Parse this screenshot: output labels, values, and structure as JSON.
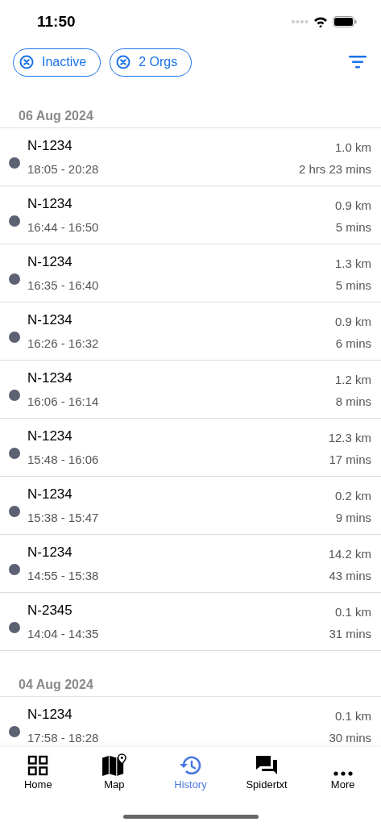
{
  "status_bar": {
    "time": "11:50"
  },
  "filters": [
    {
      "label": "Inactive"
    },
    {
      "label": "2 Orgs"
    }
  ],
  "sections": [
    {
      "date": "06 Aug 2024",
      "trips": [
        {
          "name": "N-1234",
          "time": "18:05 - 20:28",
          "distance": "1.0 km",
          "duration": "2 hrs 23 mins"
        },
        {
          "name": "N-1234",
          "time": "16:44 - 16:50",
          "distance": "0.9 km",
          "duration": "5 mins"
        },
        {
          "name": "N-1234",
          "time": "16:35 - 16:40",
          "distance": "1.3 km",
          "duration": "5 mins"
        },
        {
          "name": "N-1234",
          "time": "16:26 - 16:32",
          "distance": "0.9 km",
          "duration": "6 mins"
        },
        {
          "name": "N-1234",
          "time": "16:06 - 16:14",
          "distance": "1.2 km",
          "duration": "8 mins"
        },
        {
          "name": "N-1234",
          "time": "15:48 - 16:06",
          "distance": "12.3 km",
          "duration": "17 mins"
        },
        {
          "name": "N-1234",
          "time": "15:38 - 15:47",
          "distance": "0.2 km",
          "duration": "9 mins"
        },
        {
          "name": "N-1234",
          "time": "14:55 - 15:38",
          "distance": "14.2 km",
          "duration": "43 mins"
        },
        {
          "name": "N-2345",
          "time": "14:04 - 14:35",
          "distance": "0.1 km",
          "duration": "31 mins"
        }
      ]
    },
    {
      "date": "04 Aug 2024",
      "trips": [
        {
          "name": "N-1234",
          "time": "17:58 - 18:28",
          "distance": "0.1 km",
          "duration": "30 mins"
        }
      ]
    }
  ],
  "tab_bar": [
    {
      "label": "Home",
      "kind": "grid",
      "selected": false
    },
    {
      "label": "Map",
      "kind": "map",
      "selected": false
    },
    {
      "label": "History",
      "kind": "history",
      "selected": true
    },
    {
      "label": "Spidertxt",
      "kind": "chat",
      "selected": false
    },
    {
      "label": "More",
      "kind": "more",
      "selected": false
    }
  ]
}
